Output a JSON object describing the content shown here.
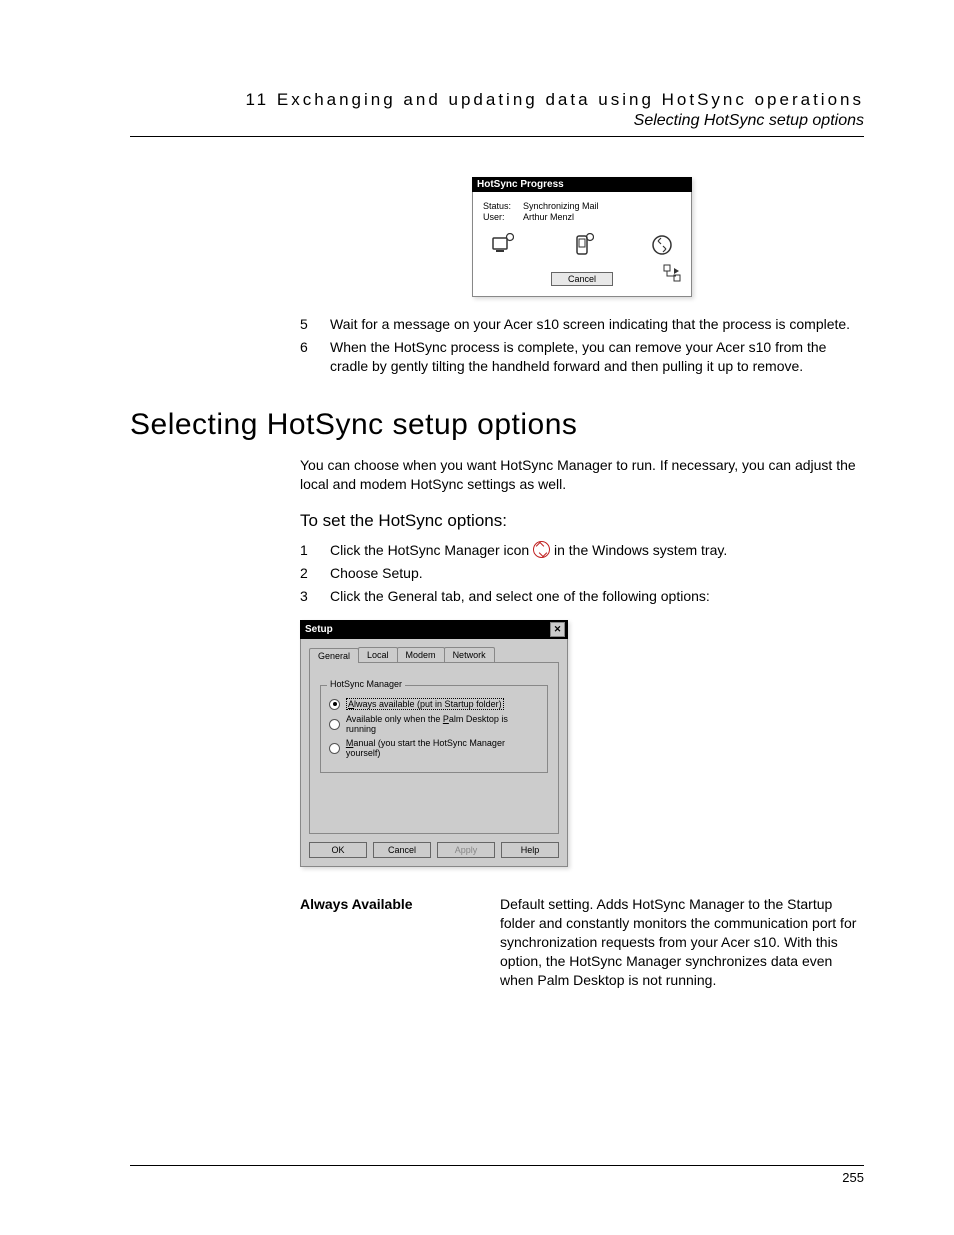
{
  "header": {
    "chapter": "11 Exchanging and updating data using HotSync operations",
    "subtitle": "Selecting HotSync setup options"
  },
  "progress_dialog": {
    "title": "HotSync Progress",
    "status_label": "Status:",
    "status_value": "Synchronizing Mail",
    "user_label": "User:",
    "user_value": "Arthur Menzl",
    "cancel": "Cancel"
  },
  "pre_steps": [
    {
      "n": "5",
      "text": "Wait for a message on your Acer s10 screen indicating that the process is complete."
    },
    {
      "n": "6",
      "text": "When the HotSync process is complete, you can remove your Acer s10 from the cradle by gently tilting the handheld forward and then pulling it up to remove."
    }
  ],
  "section_heading": "Selecting HotSync setup options",
  "intro": "You can choose when you want HotSync Manager to run. If necessary, you can adjust the local and modem HotSync settings as well.",
  "subheading": "To set the HotSync options:",
  "steps": [
    {
      "n": "1",
      "before": "Click the HotSync Manager icon ",
      "after": " in the Windows system tray."
    },
    {
      "n": "2",
      "text": "Choose Setup."
    },
    {
      "n": "3",
      "text": "Click the General tab, and select one of the following options:"
    }
  ],
  "setup_dialog": {
    "title": "Setup",
    "tabs": [
      "General",
      "Local",
      "Modem",
      "Network"
    ],
    "group_label": "HotSync Manager",
    "radios": {
      "r1": {
        "prefix": "A",
        "rest": "lways available (put in Startup folder)"
      },
      "r2": {
        "before": "Available only when the ",
        "u": "P",
        "after": "alm Desktop is running"
      },
      "r3": {
        "u": "M",
        "after": "anual (you start the HotSync Manager yourself)"
      }
    },
    "buttons": {
      "ok": "OK",
      "cancel": "Cancel",
      "apply": "Apply",
      "help": "Help"
    }
  },
  "desc": {
    "term": "Always Available",
    "def": "Default setting. Adds HotSync Manager to the Startup folder and constantly monitors the communication port for synchronization requests from your Acer s10. With this option, the HotSync Manager synchronizes data even when Palm Desktop is not running."
  },
  "page_number": "255"
}
